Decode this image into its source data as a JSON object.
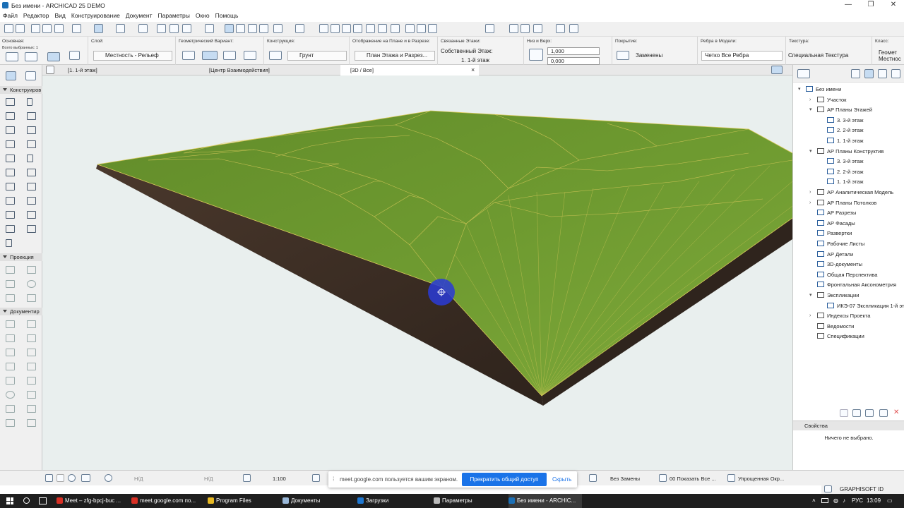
{
  "window": {
    "title": "Без имени - ARCHICAD 25 DEMO",
    "minimize": "—",
    "maximize": "❐",
    "close": "✕"
  },
  "menu": [
    "Файл",
    "Редактор",
    "Вид",
    "Конструирование",
    "Документ",
    "Параметры",
    "Окно",
    "Помощь"
  ],
  "info": {
    "main_caption": "Основная:",
    "selected_caption": "Всего выбранных: 1",
    "layer_caption": "Слой:",
    "layer_value": "Местность - Рельеф",
    "geom_caption": "Геометрический Вариант:",
    "construction_caption": "Конструкция:",
    "construction_value": "Грунт",
    "display_caption": "Отображение на Плане и в Разрезе:",
    "display_value": "План Этажа и Разрез...",
    "linked_caption": "Связанные Этажи:",
    "home_story_label": "Собственный Этаж:",
    "home_story_value": "1. 1-й этаж",
    "bottom_top_caption": "Низ и Верх:",
    "top_value": "1,000",
    "bottom_value": "0,000",
    "surface_caption": "Покрытие:",
    "surface_value": "Заменены",
    "edges_caption": "Ребра в Модели:",
    "edges_value": "Четко Все Ребра",
    "texture_caption": "Текстура:",
    "texture_value": "Специальная Текстура",
    "class_caption": "Класс:",
    "class_value_1": "Геомет",
    "class_value_2": "Местнос"
  },
  "tabs": [
    {
      "label": "[1. 1-й этаж]"
    },
    {
      "label": "[Центр Взаимодействия]"
    },
    {
      "label": "[3D / Все]"
    }
  ],
  "tab_close": "×",
  "toolbox": {
    "sections": [
      "Конструиров",
      "Проекция",
      "Документир"
    ]
  },
  "navigator": {
    "items": [
      {
        "label": "Без имени",
        "level": 0,
        "twisty": "▾",
        "kind": "project"
      },
      {
        "label": "Участок",
        "level": 1,
        "twisty": "›",
        "kind": "folder"
      },
      {
        "label": "АР Планы Этажей",
        "level": 1,
        "twisty": "▾",
        "kind": "folder"
      },
      {
        "label": "3. 3-й этаж",
        "level": 2,
        "twisty": "",
        "kind": "view"
      },
      {
        "label": "2. 2-й этаж",
        "level": 2,
        "twisty": "",
        "kind": "view"
      },
      {
        "label": "1. 1-й этаж",
        "level": 2,
        "twisty": "",
        "kind": "view"
      },
      {
        "label": "АР Планы Конструктив",
        "level": 1,
        "twisty": "▾",
        "kind": "folder"
      },
      {
        "label": "3. 3-й этаж",
        "level": 2,
        "twisty": "",
        "kind": "view"
      },
      {
        "label": "2. 2-й этаж",
        "level": 2,
        "twisty": "",
        "kind": "view"
      },
      {
        "label": "1. 1-й этаж",
        "level": 2,
        "twisty": "",
        "kind": "view"
      },
      {
        "label": "АР Аналитическая Модель",
        "level": 1,
        "twisty": "›",
        "kind": "folder"
      },
      {
        "label": "АР Планы Потолков",
        "level": 1,
        "twisty": "›",
        "kind": "folder"
      },
      {
        "label": "АР Разрезы",
        "level": 1,
        "twisty": "",
        "kind": "view"
      },
      {
        "label": "АР Фасады",
        "level": 1,
        "twisty": "",
        "kind": "view"
      },
      {
        "label": "Развертки",
        "level": 1,
        "twisty": "",
        "kind": "view"
      },
      {
        "label": "Рабочие Листы",
        "level": 1,
        "twisty": "",
        "kind": "view"
      },
      {
        "label": "АР Детали",
        "level": 1,
        "twisty": "",
        "kind": "view"
      },
      {
        "label": "3D-документы",
        "level": 1,
        "twisty": "",
        "kind": "view"
      },
      {
        "label": "Общая Перспектива",
        "level": 1,
        "twisty": "",
        "kind": "view"
      },
      {
        "label": "Фронтальная Аксонометрия",
        "level": 1,
        "twisty": "",
        "kind": "view"
      },
      {
        "label": "Экспликации",
        "level": 1,
        "twisty": "▾",
        "kind": "folder"
      },
      {
        "label": "ИКЭ-07 Экспликация 1-й этаж",
        "level": 2,
        "twisty": "",
        "kind": "table"
      },
      {
        "label": "Индексы Проекта",
        "level": 1,
        "twisty": "›",
        "kind": "folder"
      },
      {
        "label": "Ведомости",
        "level": 1,
        "twisty": "",
        "kind": "folder"
      },
      {
        "label": "Спецификации",
        "level": 1,
        "twisty": "",
        "kind": "folder"
      }
    ]
  },
  "properties": {
    "title": "Свойства",
    "empty": "Ничего не выбрано."
  },
  "status": {
    "nd1": "Н/Д",
    "nd2": "Н/Д",
    "scale": "1:100",
    "override": "Без Замены",
    "show_all": "00 Показать Все ...",
    "simplified": "Упрощенная Окр..."
  },
  "share": {
    "message": "meet.google.com пользуется вашим экраном.",
    "stop": "Прекратить общий доступ",
    "hide": "Скрыть"
  },
  "brand": "GRAPHISOFT ID",
  "taskbar": {
    "items": [
      {
        "label": "Meet – zfg-bpcj-buc ...",
        "color": "#d93025"
      },
      {
        "label": "meet.google.com по...",
        "color": "#d93025"
      },
      {
        "label": "Program Files",
        "color": "#e8b923"
      },
      {
        "label": "Документы",
        "color": "#9ab8d8"
      },
      {
        "label": "Загрузки",
        "color": "#1f77d0"
      },
      {
        "label": "Параметры",
        "color": "#bbbbbb"
      },
      {
        "label": "Без имени - ARCHIC...",
        "color": "#1b6fb5"
      }
    ],
    "lang": "РУС",
    "time": "13:09"
  },
  "colors": {
    "terrain": "#6f9a2e",
    "mesh_lines": "#d8c95a",
    "soil": "#3d2e25",
    "sky": "#e9efee",
    "accent": "#1a73e8"
  }
}
